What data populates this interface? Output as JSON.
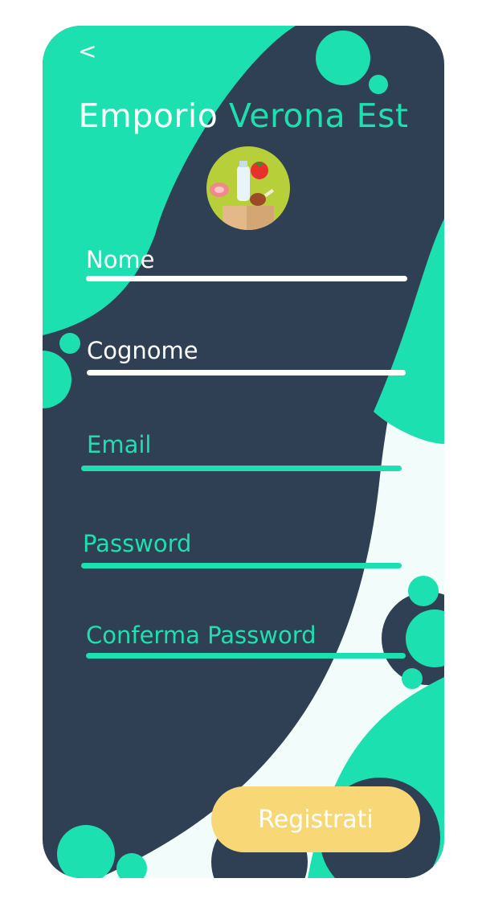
{
  "header": {
    "back_label": "<",
    "title_part1": "Emporio",
    "title_part2": "Verona Est"
  },
  "form": {
    "fields": [
      {
        "label": "Nome",
        "value": ""
      },
      {
        "label": "Cognome",
        "value": ""
      },
      {
        "label": "Email",
        "value": ""
      },
      {
        "label": "Password",
        "value": ""
      },
      {
        "label": "Conferma Password",
        "value": ""
      }
    ],
    "submit_label": "Registrati"
  },
  "colors": {
    "background_dark": "#2f3f54",
    "accent_green": "#1de0b0",
    "pale_mint": "#f2fdfb",
    "button_yellow": "#f8d876",
    "field_text_white": "#ffffff"
  },
  "icons": {
    "logo": "grocery-bag-logo-icon"
  }
}
